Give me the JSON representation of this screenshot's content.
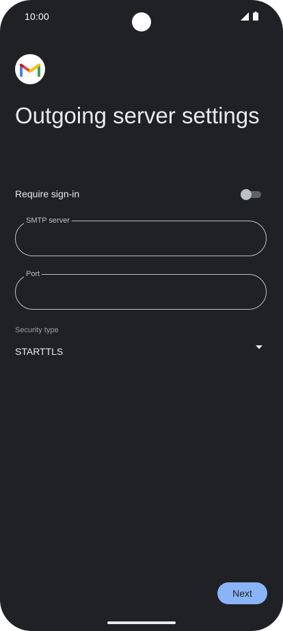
{
  "status_bar": {
    "time": "10:00",
    "icons": [
      "signal-icon",
      "battery-icon"
    ]
  },
  "app": {
    "logo": "gmail-logo"
  },
  "page": {
    "title": "Outgoing server settings"
  },
  "require_signin": {
    "label": "Require sign-in",
    "enabled": false
  },
  "fields": {
    "smtp": {
      "label": "SMTP server",
      "value": ""
    },
    "port": {
      "label": "Port",
      "value": ""
    }
  },
  "security": {
    "label": "Security type",
    "value": "STARTTLS"
  },
  "actions": {
    "next_label": "Next"
  },
  "colors": {
    "background": "#202124",
    "accent": "#8ab4f8",
    "text": "#e8eaed"
  }
}
